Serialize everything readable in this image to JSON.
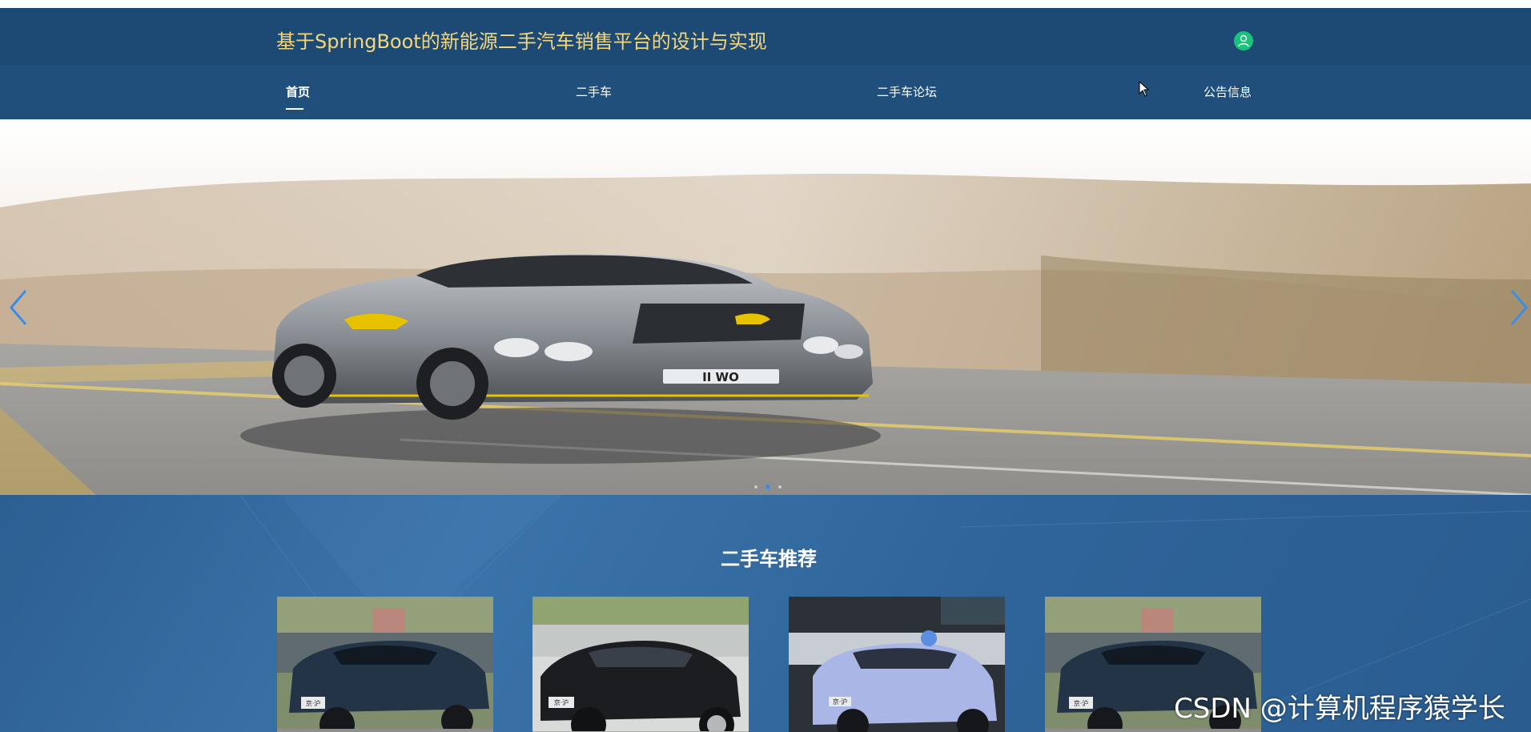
{
  "header": {
    "title": "基于SpringBoot的新能源二手汽车销售平台的设计与实现",
    "user_icon": "user-icon"
  },
  "nav": {
    "items": [
      {
        "label": "首页",
        "active": true
      },
      {
        "label": "二手车",
        "active": false
      },
      {
        "label": "二手车论坛",
        "active": false
      },
      {
        "label": "公告信息",
        "active": false
      }
    ]
  },
  "banner": {
    "prev_icon": "chevron-left-icon",
    "next_icon": "chevron-right-icon",
    "slide_count": 3,
    "active_slide": 2,
    "plate_text": "II WO"
  },
  "recommend": {
    "title": "二手车推荐",
    "cards": [
      {
        "alt": "dark blue sedan",
        "plate": "京·沪"
      },
      {
        "alt": "black sedan",
        "plate": "京·沪"
      },
      {
        "alt": "light blue electric car",
        "plate": "京·沪"
      },
      {
        "alt": "dark blue sedan",
        "plate": "京·沪"
      }
    ]
  },
  "watermark": "CSDN @计算机程序猿学长",
  "colors": {
    "header_bg": "#1d4a74",
    "nav_bg": "#1f4f7a",
    "title_color": "#f5d77a",
    "user_icon": "#19c37d",
    "section_bg": "#2f659b",
    "arrow_color": "#3a8ee6"
  }
}
